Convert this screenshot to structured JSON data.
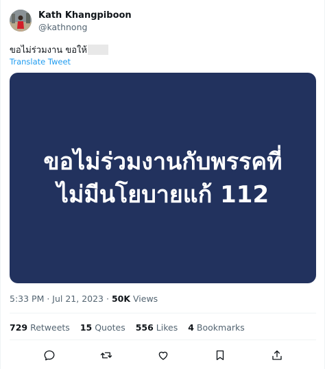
{
  "author": {
    "display_name": "Kath Khangpiboon",
    "handle": "@kathnong"
  },
  "tweet": {
    "text": "ขอไม่ร่วมงาน ขอให้",
    "translate_label": "Translate Tweet",
    "image_text": [
      "ขอไม่ร่วมงานกับพรรคที่",
      "ไม่มีนโยบายแก้ 112"
    ],
    "image_bg": "#22325e"
  },
  "meta": {
    "timestamp": "5:33 PM · Jul 21, 2023 · ",
    "views_count": "50K",
    "views_label": " Views"
  },
  "stats": [
    {
      "count": "729",
      "label": " Retweets"
    },
    {
      "count": "15",
      "label": " Quotes"
    },
    {
      "count": "556",
      "label": " Likes"
    },
    {
      "count": "4",
      "label": " Bookmarks"
    }
  ],
  "actions": [
    "reply-icon",
    "retweet-icon",
    "like-icon",
    "bookmark-icon",
    "share-icon"
  ],
  "colors": {
    "link": "#1d9bf0",
    "muted": "#536471",
    "text": "#0f1419"
  }
}
